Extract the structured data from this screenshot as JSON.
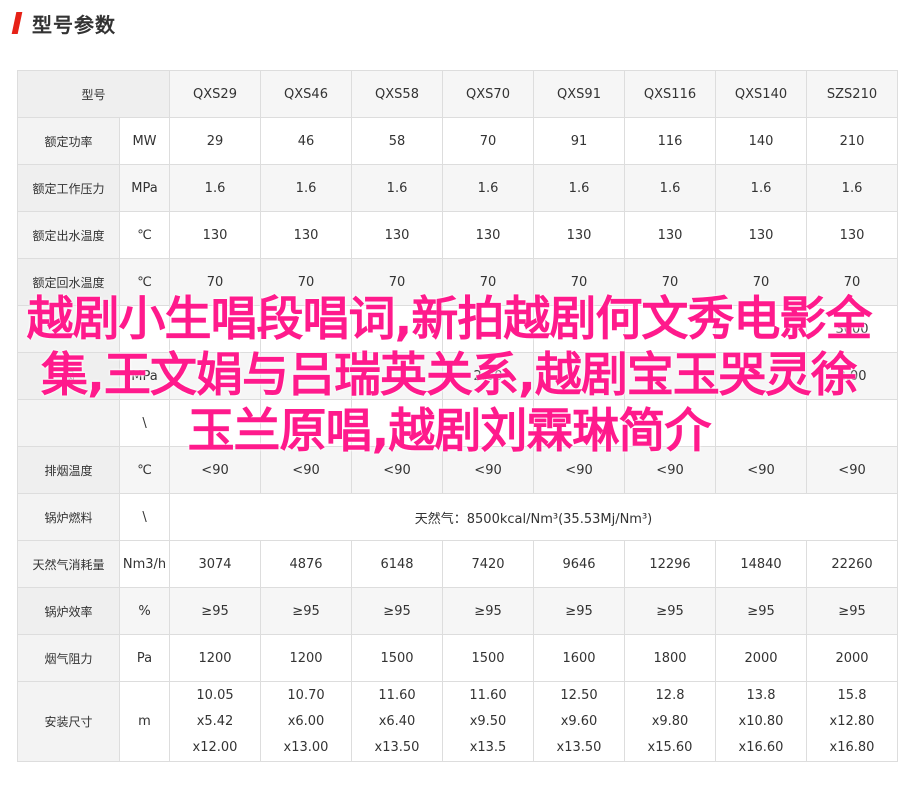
{
  "header": {
    "title": "型号参数"
  },
  "columns": [
    "QXS29",
    "QXS46",
    "QXS58",
    "QXS70",
    "QXS91",
    "QXS116",
    "QXS140",
    "SZS210"
  ],
  "header_row_label": "型号",
  "rows": [
    {
      "label": "额定功率",
      "unit": "MW",
      "values": [
        "29",
        "46",
        "58",
        "70",
        "91",
        "116",
        "140",
        "210"
      ]
    },
    {
      "label": "额定工作压力",
      "unit": "MPa",
      "values": [
        "1.6",
        "1.6",
        "1.6",
        "1.6",
        "1.6",
        "1.6",
        "1.6",
        "1.6"
      ]
    },
    {
      "label": "额定出水温度",
      "unit": "℃",
      "values": [
        "130",
        "130",
        "130",
        "130",
        "130",
        "130",
        "130",
        "130"
      ]
    },
    {
      "label": "额定回水温度",
      "unit": "℃",
      "values": [
        "70",
        "70",
        "70",
        "70",
        "70",
        "70",
        "70",
        "70"
      ]
    },
    {
      "label": "",
      "unit": "",
      "values": [
        "",
        "",
        "",
        "",
        "",
        "",
        "",
        "3000"
      ]
    },
    {
      "label": "锅",
      "unit": "MPa",
      "values": [
        "",
        "",
        "",
        "2.00",
        "",
        "",
        "",
        "2.00"
      ]
    },
    {
      "label": "",
      "unit": "\\",
      "values": [
        "",
        "",
        "",
        "",
        "",
        "",
        "",
        ""
      ]
    },
    {
      "label": "排烟温度",
      "unit": "℃",
      "values": [
        "<90",
        "<90",
        "<90",
        "<90",
        "<90",
        "<90",
        "<90",
        "<90"
      ]
    }
  ],
  "fuel_row": {
    "label": "锅炉燃料",
    "unit": "\\",
    "value": "天然气：8500kcal/Nm³(35.53Mj/Nm³)"
  },
  "rows2": [
    {
      "label": "天然气消耗量",
      "unit": "Nm3/h",
      "values": [
        "3074",
        "4876",
        "6148",
        "7420",
        "9646",
        "12296",
        "14840",
        "22260"
      ]
    },
    {
      "label": "锅炉效率",
      "unit": "%",
      "values": [
        "≥95",
        "≥95",
        "≥95",
        "≥95",
        "≥95",
        "≥95",
        "≥95",
        "≥95"
      ]
    },
    {
      "label": "烟气阻力",
      "unit": "Pa",
      "values": [
        "1200",
        "1200",
        "1500",
        "1500",
        "1600",
        "1800",
        "2000",
        "2000"
      ]
    }
  ],
  "size_row": {
    "label": "安装尺寸",
    "unit": "m",
    "values": [
      [
        "10.05",
        "x5.42",
        "x12.00"
      ],
      [
        "10.70",
        "x6.00",
        "x13.00"
      ],
      [
        "11.60",
        "x6.40",
        "x13.50"
      ],
      [
        "11.60",
        "x9.50",
        "x13.5"
      ],
      [
        "12.50",
        "x9.60",
        "x13.50"
      ],
      [
        "12.8",
        "x9.80",
        "x15.60"
      ],
      [
        "13.8",
        "x10.80",
        "x16.60"
      ],
      [
        "15.8",
        "x12.80",
        "x16.80"
      ]
    ]
  },
  "overlay": {
    "text": "越剧小生唱段唱词,新拍越剧何文秀电影全集,王文娟与吕瑞英关系,越剧宝玉哭灵徐玉兰原唱,越剧刘霖琳简介",
    "color": "#ff1a8c"
  },
  "colors": {
    "accent": "#e62117",
    "border": "#dddddd",
    "label_bg": "#f3f3f3"
  }
}
